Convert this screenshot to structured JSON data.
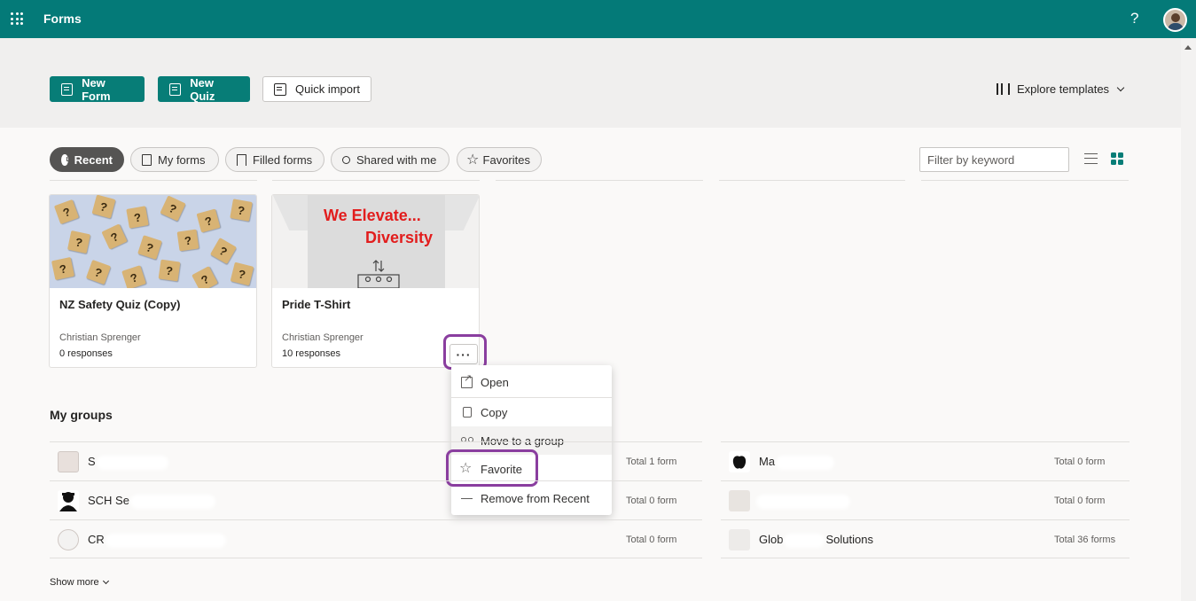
{
  "app": {
    "title": "Forms",
    "help": "?"
  },
  "hero": {
    "new_form": "New Form",
    "new_quiz": "New Quiz",
    "quick_import": "Quick import",
    "explore_templates": "Explore templates"
  },
  "tabs": [
    {
      "label": "Recent",
      "active": true
    },
    {
      "label": "My forms"
    },
    {
      "label": "Filled forms"
    },
    {
      "label": "Shared with me"
    },
    {
      "label": "Favorites"
    }
  ],
  "filter": {
    "placeholder": "Filter by keyword"
  },
  "cards": [
    {
      "title": "NZ Safety Quiz (Copy)",
      "owner": "Christian Sprenger",
      "responses": "0 responses"
    },
    {
      "title": "Pride T-Shirt",
      "owner": "Christian Sprenger",
      "responses": "10 responses",
      "thumb_line1": "We Elevate...",
      "thumb_line2": "Diversity"
    }
  ],
  "more_button": "···",
  "menu": [
    {
      "label": "Open",
      "icon": "open-in-new-icon"
    },
    {
      "label": "Copy",
      "icon": "copy-icon"
    },
    {
      "label": "Move to a group",
      "icon": "group-icon"
    },
    {
      "label": "Favorite",
      "icon": "star-icon"
    },
    {
      "label": "Remove from Recent",
      "icon": "remove-icon"
    }
  ],
  "groups": {
    "title": "My groups",
    "left": [
      {
        "name": "S",
        "total": "Total 1 form"
      },
      {
        "name": "SCH Se",
        "total": "Total 0 form"
      },
      {
        "name": "CR",
        "total": "Total 0 form"
      }
    ],
    "right": [
      {
        "name": "Ma",
        "total": "Total 0 form"
      },
      {
        "name": "",
        "total": "Total 0 form"
      },
      {
        "name": "Glob",
        "name_tail": "Solutions",
        "total": "Total 36 forms"
      }
    ],
    "show_more": "Show more"
  },
  "colors": {
    "brand": "#047a78",
    "primary_button": "#077d77",
    "highlight": "#8a3e9f"
  }
}
